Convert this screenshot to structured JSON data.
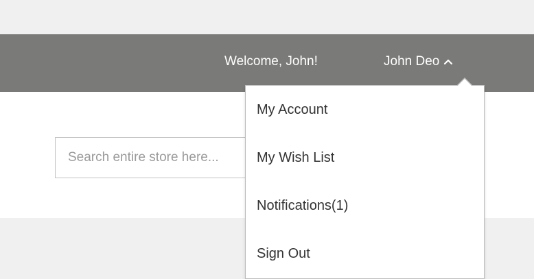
{
  "header": {
    "welcome_text": "Welcome, John!",
    "account_name": "John Deo"
  },
  "search": {
    "placeholder": "Search entire store here..."
  },
  "account_menu": {
    "items": [
      {
        "label": "My Account"
      },
      {
        "label": "My Wish List"
      },
      {
        "label": "Notifications(1)"
      },
      {
        "label": "Sign Out"
      }
    ]
  },
  "icons": {
    "account_toggle": "chevron-up-icon"
  },
  "colors": {
    "header_bg": "#7a7a78",
    "page_bg": "#f0f0f0",
    "menu_text": "#333333",
    "menu_border": "#bbbbbb"
  }
}
